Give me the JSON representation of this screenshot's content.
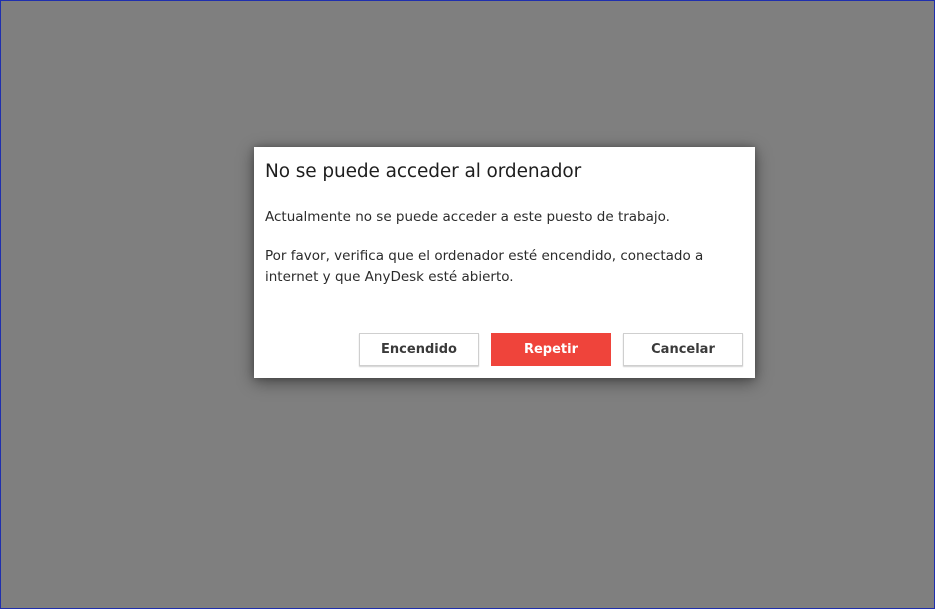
{
  "dialog": {
    "title": "No se puede acceder al ordenador",
    "message": "Actualmente no se puede acceder a este puesto de trabajo.",
    "detail": "Por favor, verifica que el ordenador esté encendido, conectado a internet y que AnyDesk esté abierto."
  },
  "buttons": {
    "powered_label": "Encendido",
    "retry_label": "Repetir",
    "cancel_label": "Cancelar"
  },
  "colors": {
    "overlay": "#7f7f7f",
    "primary": "#ef443b",
    "window_border": "#1f2fae"
  }
}
